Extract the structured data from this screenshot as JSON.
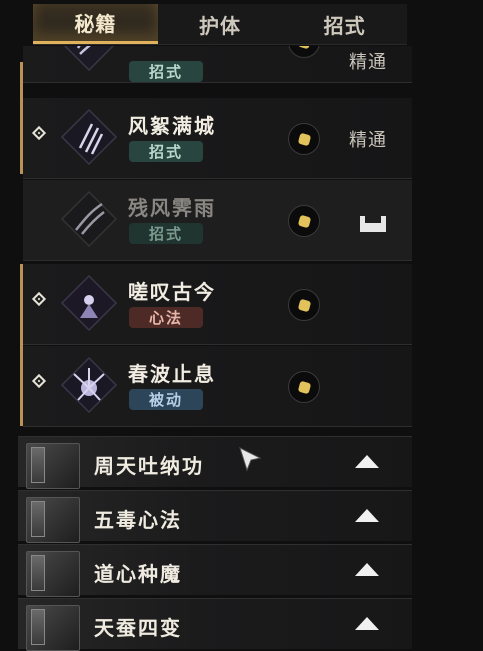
{
  "tabs": [
    "秘籍",
    "护体",
    "招式"
  ],
  "active_tab": 0,
  "skills": [
    {
      "name": "",
      "tag": "招式",
      "tag_color": "green",
      "status": "精通",
      "partial": true
    },
    {
      "name": "风絮满城",
      "tag": "招式",
      "tag_color": "green",
      "status": "精通",
      "pinned": true
    },
    {
      "name": "残风霁雨",
      "tag": "招式",
      "tag_color": "green",
      "status": "",
      "locked": true
    },
    {
      "name": "嗟叹古今",
      "tag": "心法",
      "tag_color": "red",
      "status": "",
      "pinned": true
    },
    {
      "name": "春波止息",
      "tag": "被动",
      "tag_color": "blue",
      "status": "",
      "pinned": true
    }
  ],
  "books": [
    {
      "title": "周天吐纳功"
    },
    {
      "title": "五毒心法"
    },
    {
      "title": "道心种魔"
    },
    {
      "title": "天蚕四变"
    }
  ],
  "icons": {
    "pin": "diamond-pin-icon",
    "coin": "gold-coin-icon",
    "expand": "triangle-up-icon",
    "tray": "equip-tray-icon",
    "cursor": "mouse-pointer-icon"
  }
}
